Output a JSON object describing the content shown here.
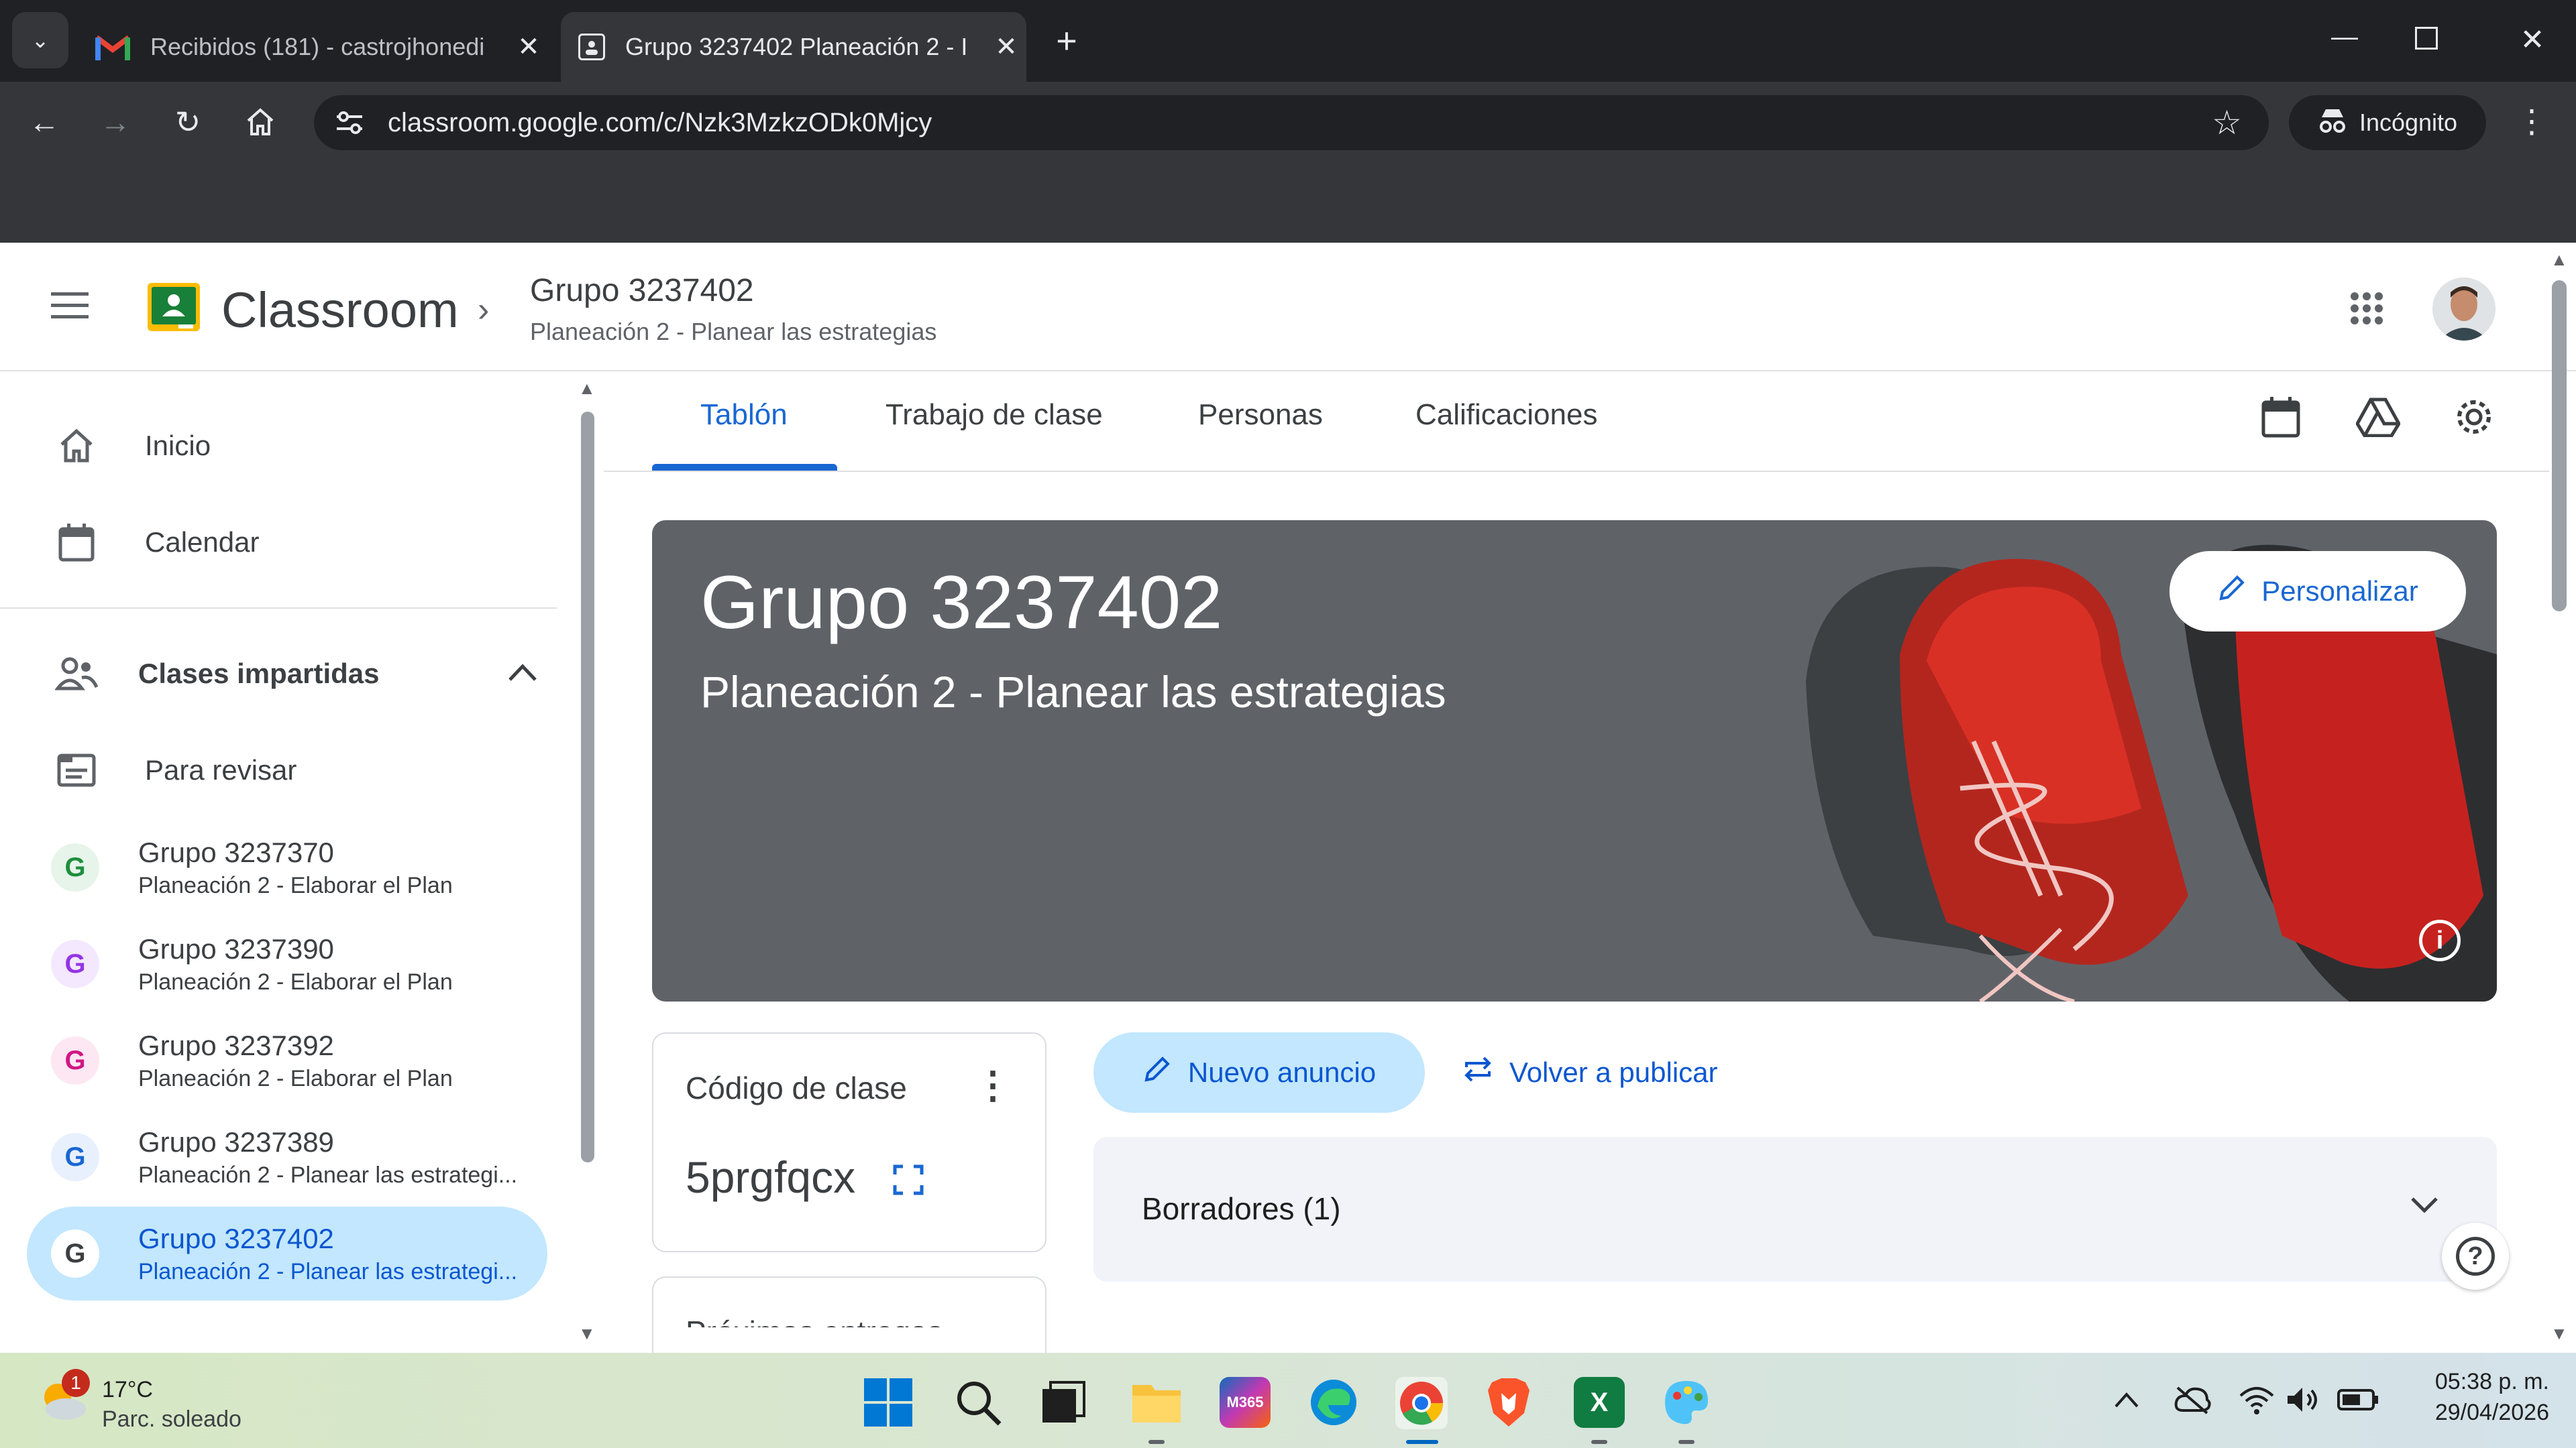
{
  "browser": {
    "tabs": [
      {
        "title": "Recibidos (181) - castrojhonedi",
        "icon": "gmail-icon"
      },
      {
        "title": "Grupo 3237402 Planeación 2 - I",
        "icon": "classroom-tab-icon"
      }
    ],
    "url": "classroom.google.com/c/Nzk3MzkzODk0Mjcy",
    "incognito_label": "Incógnito"
  },
  "app": {
    "name": "Classroom",
    "breadcrumb": {
      "title": "Grupo 3237402",
      "subtitle": "Planeación 2 - Planear las estrategias"
    }
  },
  "sidebar": {
    "nav": [
      {
        "label": "Inicio",
        "icon": "home-icon"
      },
      {
        "label": "Calendar",
        "icon": "calendar-icon"
      }
    ],
    "section_label": "Clases impartidas",
    "review_label": "Para revisar",
    "classes": [
      {
        "letter": "G",
        "title": "Grupo 3237370",
        "subtitle": "Planeación 2 - Elaborar el Plan",
        "color": "#1e8e3e"
      },
      {
        "letter": "G",
        "title": "Grupo 3237390",
        "subtitle": "Planeación 2 - Elaborar el Plan",
        "color": "#9334e6"
      },
      {
        "letter": "G",
        "title": "Grupo 3237392",
        "subtitle": "Planeación 2 - Elaborar el Plan",
        "color": "#d01884"
      },
      {
        "letter": "G",
        "title": "Grupo 3237389",
        "subtitle": "Planeación 2 - Planear las estrategi...",
        "color": "#1967d2"
      },
      {
        "letter": "G",
        "title": "Grupo 3237402",
        "subtitle": "Planeación 2 - Planear las estrategi...",
        "color": "#3c4043"
      }
    ]
  },
  "tabs": [
    "Tablón",
    "Trabajo de clase",
    "Personas",
    "Calificaciones"
  ],
  "active_tab": "Tablón",
  "banner": {
    "title": "Grupo 3237402",
    "subtitle": "Planeación 2 - Planear las estrategias",
    "customize_label": "Personalizar"
  },
  "class_code": {
    "label": "Código de clase",
    "value": "5prgfqcx"
  },
  "next_card_label": "Próximas entregas",
  "actions": {
    "new_announcement": "Nuevo anuncio",
    "republish": "Volver a publicar"
  },
  "drafts_label": "Borradores (1)",
  "taskbar": {
    "weather": {
      "temp": "17°C",
      "desc": "Parc. soleado",
      "badge": "1"
    },
    "time": "05:38 p. m.",
    "date": "29/04/2026"
  },
  "colors": {
    "accent": "#1967d2",
    "active_bg": "#c2e7ff"
  }
}
